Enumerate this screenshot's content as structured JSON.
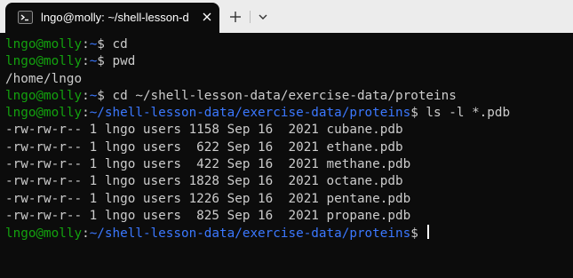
{
  "window": {
    "tab_title": "lngo@molly: ~/shell-lesson-d",
    "tab_icon": "linux-terminal-icon",
    "close_icon": "close-icon",
    "new_tab_icon": "plus-icon",
    "dropdown_icon": "chevron-down-icon"
  },
  "colors": {
    "background": "#0c0c0c",
    "prompt_user": "#13a10e",
    "prompt_path": "#3b78ff",
    "text": "#cccccc",
    "titlebar": "#ececec"
  },
  "terminal": {
    "lines": [
      {
        "user": "lngo@molly",
        "colon": ":",
        "path": "~",
        "symbol": "$ ",
        "command": "cd"
      },
      {
        "user": "lngo@molly",
        "colon": ":",
        "path": "~",
        "symbol": "$ ",
        "command": "pwd"
      },
      {
        "output": "/home/lngo"
      },
      {
        "user": "lngo@molly",
        "colon": ":",
        "path": "~",
        "symbol": "$ ",
        "command": "cd ~/shell-lesson-data/exercise-data/proteins"
      },
      {
        "user": "lngo@molly",
        "colon": ":",
        "path": "~/shell-lesson-data/exercise-data/proteins",
        "symbol": "$ ",
        "command": "ls -l *.pdb"
      },
      {
        "output": "-rw-rw-r-- 1 lngo users 1158 Sep 16  2021 cubane.pdb"
      },
      {
        "output": "-rw-rw-r-- 1 lngo users  622 Sep 16  2021 ethane.pdb"
      },
      {
        "output": "-rw-rw-r-- 1 lngo users  422 Sep 16  2021 methane.pdb"
      },
      {
        "output": "-rw-rw-r-- 1 lngo users 1828 Sep 16  2021 octane.pdb"
      },
      {
        "output": "-rw-rw-r-- 1 lngo users 1226 Sep 16  2021 pentane.pdb"
      },
      {
        "output": "-rw-rw-r-- 1 lngo users  825 Sep 16  2021 propane.pdb"
      },
      {
        "user": "lngo@molly",
        "colon": ":",
        "path": "~/shell-lesson-data/exercise-data/proteins",
        "symbol": "$ ",
        "command": "",
        "cursor": true
      }
    ]
  }
}
